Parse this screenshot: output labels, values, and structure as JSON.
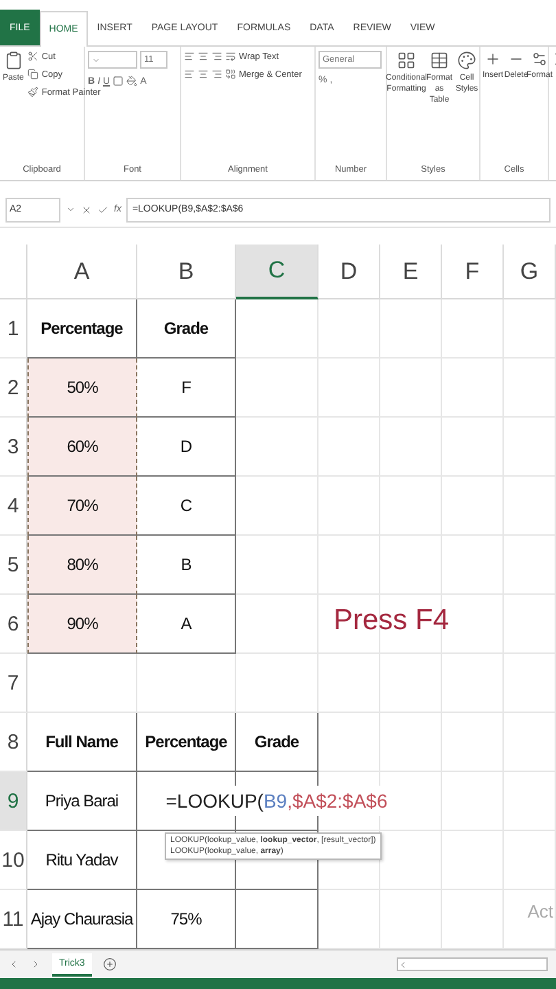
{
  "ribbon_tabs": [
    {
      "label": "FILE",
      "kind": "file",
      "selected": false
    },
    {
      "label": "HOME",
      "kind": "tab",
      "selected": true
    },
    {
      "label": "INSERT",
      "kind": "tab",
      "selected": false
    },
    {
      "label": "PAGE LAYOUT",
      "kind": "tab",
      "selected": false
    },
    {
      "label": "FORMULAS",
      "kind": "tab",
      "selected": false
    },
    {
      "label": "DATA",
      "kind": "tab",
      "selected": false
    },
    {
      "label": "REVIEW",
      "kind": "tab",
      "selected": false
    },
    {
      "label": "VIEW",
      "kind": "tab",
      "selected": false
    }
  ],
  "ribbon": {
    "clipboard": {
      "paste": "Paste",
      "cut": "Cut",
      "copy": "Copy",
      "format_painter": "Format Painter",
      "name": "Clipboard"
    },
    "font": {
      "size": "11",
      "bold": "B",
      "italic": "I",
      "underline": "U",
      "font_color": "A",
      "name": "Font"
    },
    "alignment": {
      "wrap_text": "Wrap Text",
      "merge_center": "Merge & Center",
      "name": "Alignment"
    },
    "number": {
      "format": "General",
      "percent": "%",
      "comma": ",",
      "name": "Number"
    },
    "styles": {
      "conditional_formatting": "Conditional Formatting",
      "format_as_table": "Format as Table",
      "cell_styles": "Cell Styles",
      "name": "Styles"
    },
    "cells": {
      "insert": "Insert",
      "delete": "Delete",
      "format": "Format",
      "name": "Cells"
    }
  },
  "formula_bar": {
    "name_box": "A2",
    "function_label": "fx",
    "formula": "=LOOKUP(B9,$A$2:$A$6"
  },
  "columns": [
    {
      "label": "A",
      "selected": false
    },
    {
      "label": "B",
      "selected": false
    },
    {
      "label": "C",
      "selected": true
    },
    {
      "label": "D",
      "selected": false
    },
    {
      "label": "E",
      "selected": false
    },
    {
      "label": "F",
      "selected": false
    },
    {
      "label": "G",
      "selected": false
    }
  ],
  "rows": [
    {
      "label": "1",
      "selected": false,
      "cells": [
        {
          "text": "Percentage",
          "kind": "header",
          "framed": true,
          "copied": false
        },
        {
          "text": "Grade",
          "kind": "header",
          "framed": true,
          "copied": false
        },
        {
          "framed": false,
          "copied": false
        },
        {
          "framed": false,
          "copied": false
        },
        {
          "framed": false,
          "copied": false
        },
        {
          "framed": false,
          "copied": false
        },
        {
          "framed": false,
          "copied": false
        }
      ]
    },
    {
      "label": "2",
      "selected": false,
      "cells": [
        {
          "text": "50%",
          "kind": "value",
          "framed": true,
          "copied": true
        },
        {
          "text": "F",
          "kind": "value",
          "framed": true,
          "copied": false
        },
        {
          "framed": false,
          "copied": false
        },
        {
          "framed": false,
          "copied": false
        },
        {
          "framed": false,
          "copied": false
        },
        {
          "framed": false,
          "copied": false
        },
        {
          "framed": false,
          "copied": false
        }
      ]
    },
    {
      "label": "3",
      "selected": false,
      "cells": [
        {
          "text": "60%",
          "kind": "value",
          "framed": true,
          "copied": true
        },
        {
          "text": "D",
          "kind": "value",
          "framed": true,
          "copied": false
        },
        {
          "framed": false,
          "copied": false
        },
        {
          "framed": false,
          "copied": false
        },
        {
          "framed": false,
          "copied": false
        },
        {
          "framed": false,
          "copied": false
        },
        {
          "framed": false,
          "copied": false
        }
      ]
    },
    {
      "label": "4",
      "selected": false,
      "cells": [
        {
          "text": "70%",
          "kind": "value",
          "framed": true,
          "copied": true
        },
        {
          "text": "C",
          "kind": "value",
          "framed": true,
          "copied": false
        },
        {
          "framed": false,
          "copied": false
        },
        {
          "framed": false,
          "copied": false
        },
        {
          "framed": false,
          "copied": false
        },
        {
          "framed": false,
          "copied": false
        },
        {
          "framed": false,
          "copied": false
        }
      ]
    },
    {
      "label": "5",
      "selected": false,
      "cells": [
        {
          "text": "80%",
          "kind": "value",
          "framed": true,
          "copied": true
        },
        {
          "text": "B",
          "kind": "value",
          "framed": true,
          "copied": false
        },
        {
          "framed": false,
          "copied": false
        },
        {
          "framed": false,
          "copied": false
        },
        {
          "framed": false,
          "copied": false
        },
        {
          "framed": false,
          "copied": false
        },
        {
          "framed": false,
          "copied": false
        }
      ]
    },
    {
      "label": "6",
      "selected": false,
      "cells": [
        {
          "text": "90%",
          "kind": "value",
          "framed": true,
          "copied": true
        },
        {
          "text": "A",
          "kind": "value",
          "framed": true,
          "copied": false
        },
        {
          "framed": false,
          "copied": false
        },
        {
          "framed": false,
          "copied": false
        },
        {
          "framed": false,
          "copied": false
        },
        {
          "framed": false,
          "copied": false
        },
        {
          "framed": false,
          "copied": false
        }
      ]
    },
    {
      "label": "7",
      "selected": false,
      "cells": [
        {
          "framed": false,
          "copied": false
        },
        {
          "framed": false,
          "copied": false
        },
        {
          "framed": false,
          "copied": false
        },
        {
          "framed": false,
          "copied": false
        },
        {
          "framed": false,
          "copied": false
        },
        {
          "framed": false,
          "copied": false
        },
        {
          "framed": false,
          "copied": false
        }
      ]
    },
    {
      "label": "8",
      "selected": false,
      "cells": [
        {
          "text": "Full Name",
          "kind": "header",
          "framed": true,
          "copied": false
        },
        {
          "text": "Percentage",
          "kind": "header",
          "framed": true,
          "copied": false
        },
        {
          "text": "Grade",
          "kind": "header",
          "framed": true,
          "copied": false
        },
        {
          "framed": false,
          "copied": false
        },
        {
          "framed": false,
          "copied": false
        },
        {
          "framed": false,
          "copied": false
        },
        {
          "framed": false,
          "copied": false
        }
      ]
    },
    {
      "label": "9",
      "selected": true,
      "cells": [
        {
          "text": "Priya Barai",
          "kind": "value",
          "framed": true,
          "copied": false
        },
        {
          "framed": true,
          "copied": false
        },
        {
          "kind": "formula",
          "framed": true,
          "copied": false,
          "parts": [
            {
              "text": "=LOOKUP(",
              "color": "#222222"
            },
            {
              "text": "B9",
              "color": "#5b7fc0"
            },
            {
              "text": ",$A$2:$A$6",
              "color": "#c2505a"
            }
          ]
        },
        {
          "framed": false,
          "copied": false
        },
        {
          "framed": false,
          "copied": false
        },
        {
          "framed": false,
          "copied": false
        },
        {
          "framed": false,
          "copied": false
        }
      ]
    },
    {
      "label": "10",
      "selected": false,
      "cells": [
        {
          "text": "Ritu Yadav",
          "kind": "value",
          "framed": true,
          "copied": false
        },
        {
          "framed": true,
          "copied": false
        },
        {
          "framed": true,
          "copied": false
        },
        {
          "framed": false,
          "copied": false
        },
        {
          "framed": false,
          "copied": false
        },
        {
          "framed": false,
          "copied": false
        },
        {
          "framed": false,
          "copied": false
        }
      ]
    },
    {
      "label": "11",
      "selected": false,
      "cells": [
        {
          "text": "Ajay Chaurasia",
          "kind": "value",
          "framed": true,
          "copied": false
        },
        {
          "text": "75%",
          "kind": "value",
          "framed": true,
          "copied": false
        },
        {
          "framed": true,
          "copied": false
        },
        {
          "framed": false,
          "copied": false
        },
        {
          "framed": false,
          "copied": false
        },
        {
          "framed": false,
          "copied": false
        },
        {
          "framed": false,
          "copied": false
        }
      ]
    }
  ],
  "tooltip": {
    "lines": [
      "LOOKUP(lookup_value, **lookup_vector**, [result_vector])",
      "LOOKUP(lookup_value, **array**)"
    ]
  },
  "annotation": "Press F4",
  "os_notice": "Act",
  "sheet_tabs": [
    {
      "label": "Trick3",
      "selected": true
    }
  ]
}
